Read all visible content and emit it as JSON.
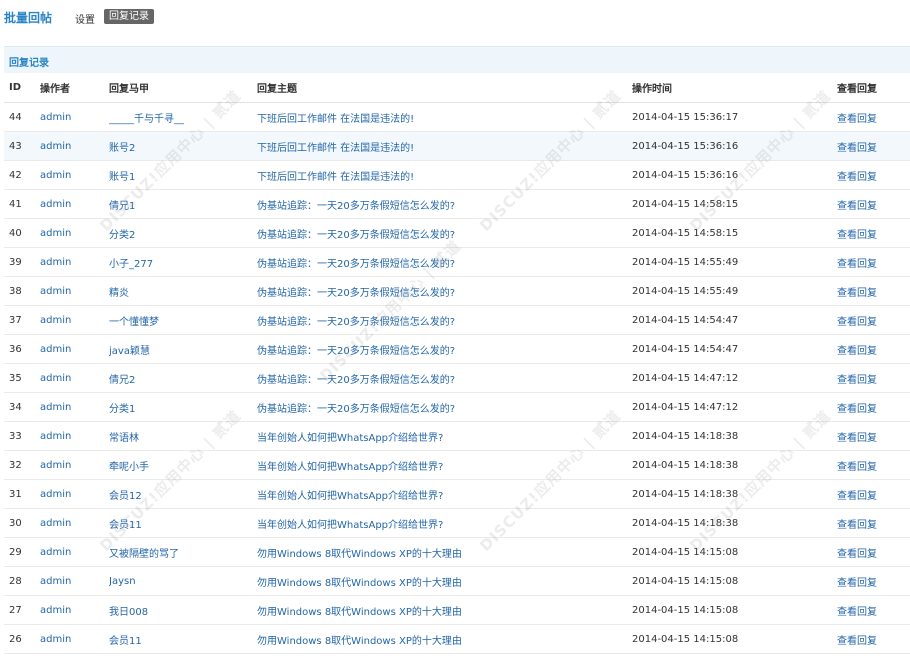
{
  "header": {
    "app_title": "批量回帖",
    "tabs": [
      {
        "label": "设置"
      },
      {
        "label": "回复记录"
      }
    ]
  },
  "section": {
    "title": "回复记录"
  },
  "table": {
    "columns": [
      "ID",
      "操作者",
      "回复马甲",
      "回复主题",
      "操作时间",
      "查看回复"
    ],
    "rows": [
      {
        "id": "44",
        "operator": "admin",
        "alias": "_____千与千寻__",
        "subject": "下班后回工作邮件 在法国是违法的!",
        "time": "2014-04-15 15:36:17",
        "action": "查看回复"
      },
      {
        "id": "43",
        "operator": "admin",
        "alias": "账号2",
        "subject": "下班后回工作邮件 在法国是违法的!",
        "time": "2014-04-15 15:36:16",
        "action": "查看回复"
      },
      {
        "id": "42",
        "operator": "admin",
        "alias": "账号1",
        "subject": "下班后回工作邮件 在法国是违法的!",
        "time": "2014-04-15 15:36:16",
        "action": "查看回复"
      },
      {
        "id": "41",
        "operator": "admin",
        "alias": "倩兄1",
        "subject": "伪基站追踪：一天20多万条假短信怎么发的?",
        "time": "2014-04-15 14:58:15",
        "action": "查看回复"
      },
      {
        "id": "40",
        "operator": "admin",
        "alias": "分类2",
        "subject": "伪基站追踪：一天20多万条假短信怎么发的?",
        "time": "2014-04-15 14:58:15",
        "action": "查看回复"
      },
      {
        "id": "39",
        "operator": "admin",
        "alias": "小子_277",
        "subject": "伪基站追踪：一天20多万条假短信怎么发的?",
        "time": "2014-04-15 14:55:49",
        "action": "查看回复"
      },
      {
        "id": "38",
        "operator": "admin",
        "alias": "精炎",
        "subject": "伪基站追踪：一天20多万条假短信怎么发的?",
        "time": "2014-04-15 14:55:49",
        "action": "查看回复"
      },
      {
        "id": "37",
        "operator": "admin",
        "alias": "一个懂懂梦",
        "subject": "伪基站追踪：一天20多万条假短信怎么发的?",
        "time": "2014-04-15 14:54:47",
        "action": "查看回复"
      },
      {
        "id": "36",
        "operator": "admin",
        "alias": "java颖慧",
        "subject": "伪基站追踪：一天20多万条假短信怎么发的?",
        "time": "2014-04-15 14:54:47",
        "action": "查看回复"
      },
      {
        "id": "35",
        "operator": "admin",
        "alias": "倩兄2",
        "subject": "伪基站追踪：一天20多万条假短信怎么发的?",
        "time": "2014-04-15 14:47:12",
        "action": "查看回复"
      },
      {
        "id": "34",
        "operator": "admin",
        "alias": "分类1",
        "subject": "伪基站追踪：一天20多万条假短信怎么发的?",
        "time": "2014-04-15 14:47:12",
        "action": "查看回复"
      },
      {
        "id": "33",
        "operator": "admin",
        "alias": "常语林",
        "subject": "当年创始人如何把WhatsApp介绍给世界?",
        "time": "2014-04-15 14:18:38",
        "action": "查看回复"
      },
      {
        "id": "32",
        "operator": "admin",
        "alias": "牵呢小手",
        "subject": "当年创始人如何把WhatsApp介绍给世界?",
        "time": "2014-04-15 14:18:38",
        "action": "查看回复"
      },
      {
        "id": "31",
        "operator": "admin",
        "alias": "会员12",
        "subject": "当年创始人如何把WhatsApp介绍给世界?",
        "time": "2014-04-15 14:18:38",
        "action": "查看回复"
      },
      {
        "id": "30",
        "operator": "admin",
        "alias": "会员11",
        "subject": "当年创始人如何把WhatsApp介绍给世界?",
        "time": "2014-04-15 14:18:38",
        "action": "查看回复"
      },
      {
        "id": "29",
        "operator": "admin",
        "alias": "又被隔壁的骂了",
        "subject": "勿用Windows 8取代Windows XP的十大理由",
        "time": "2014-04-15 14:15:08",
        "action": "查看回复"
      },
      {
        "id": "28",
        "operator": "admin",
        "alias": "Jaysn",
        "subject": "勿用Windows 8取代Windows XP的十大理由",
        "time": "2014-04-15 14:15:08",
        "action": "查看回复"
      },
      {
        "id": "27",
        "operator": "admin",
        "alias": "我日008",
        "subject": "勿用Windows 8取代Windows XP的十大理由",
        "time": "2014-04-15 14:15:08",
        "action": "查看回复"
      },
      {
        "id": "26",
        "operator": "admin",
        "alias": "会员11",
        "subject": "勿用Windows 8取代Windows XP的十大理由",
        "time": "2014-04-15 14:15:08",
        "action": "查看回复"
      }
    ]
  },
  "watermark": {
    "text": "DISCUZ!应用中心 | 贰道"
  }
}
